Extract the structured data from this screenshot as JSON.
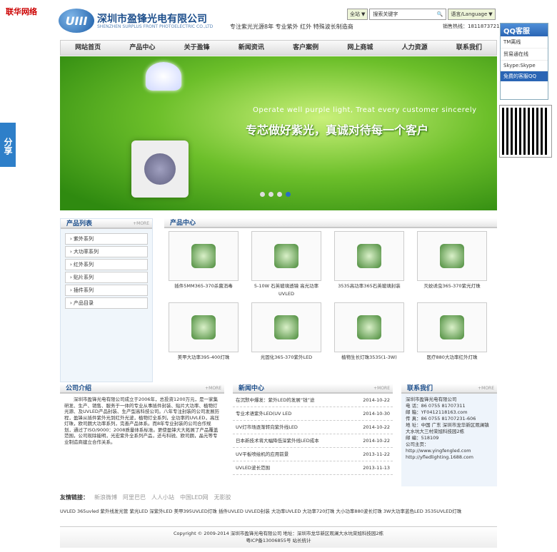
{
  "topleft": "联华网络",
  "header": {
    "logo_text": "UIII",
    "company": "深圳市盈锋光电有限公司",
    "company_en": "SHENZHEN SURPLUS FRONT PHOTOELECTRIC CO.,LTD",
    "slogan": "专注紫光光源8年 专业紫外 红外 特殊波长制造商",
    "hotline": "销售热线：18118737216"
  },
  "search": {
    "scope": "全站",
    "placeholder": "搜索关键字",
    "lang": "语言/Language"
  },
  "nav": [
    "网站首页",
    "产品中心",
    "关于盈锋",
    "新闻资讯",
    "客户案例",
    "网上商城",
    "人力资源",
    "联系我们"
  ],
  "banner": {
    "en": "Operate well purple light, Treat every customer sincerely",
    "cn": "专芯做好紫光，真诚对待每一个客户"
  },
  "qq": {
    "title": "QQ客服",
    "items": [
      "TM离线",
      "贸易通在线",
      "Skype:Skype"
    ],
    "footer": "免费的客服QQ"
  },
  "share": "分享",
  "products_list": {
    "title": "产品列表",
    "more": "+MORE",
    "items": [
      "紫外系列",
      "大功率系列",
      "红外系列",
      "贴片系列",
      "插件系列",
      "产品目录"
    ]
  },
  "products_center": {
    "title": "产品中心",
    "items": [
      "插件5MM365-370杀菌消毒",
      "5-10W 石英玻璃透镜 高光功率UVLED",
      "3535高功率365石英玻璃封装",
      "灭蚊诱虫365-370紫光灯珠",
      "美甲大功率395-400灯珠",
      "光固化365-370紫外LED",
      "植物生长灯珠3535(1-3W)",
      "医疗880大功率红外灯珠"
    ]
  },
  "about": {
    "title": "公司介绍",
    "more": "+MORE",
    "text": "深圳市盈锋光电有限公司成立于2006年，总投资1200万元，是一家集研发、生产、销售、服务于一体的专业从事插件封装、贴片大功率、植物灯光源、及UVLED产品封装、生产型高科技公司。八年专注封装的公司发展历程，盈锋从插件紫外光到红外光波，植物灯全系列，全功率的UVLED，高压灯珠，欧司朗大功率系列，完善产品体系。而8年专业封装的公司合作规划，通过了ISO/9000：2008质量体系标准。更使盈锋大大拓展了产品覆盖范围，公司现除能明，光宏紫外全系列产品，还与科锐、欧司朗，晶元等专业制造商建立合作关系。"
  },
  "news": {
    "title": "新闻中心",
    "more": "+MORE",
    "items": [
      {
        "t": "在沉默中爆发：紫外LED的发展“钱”途",
        "d": "2014-10-22"
      },
      {
        "t": "专业术语紫外LED(UV LED",
        "d": "2014-10-30"
      },
      {
        "t": "UV灯市场逐渐转向紫外线LED",
        "d": "2014-10-22"
      },
      {
        "t": "日本新技术将大幅降低深紫外线LED成本",
        "d": "2014-10-22"
      },
      {
        "t": "UV平板喷绘机的应用前景",
        "d": "2013-11-22"
      },
      {
        "t": "UVLED波长范围",
        "d": "2013-11-13"
      }
    ]
  },
  "contact": {
    "title": "联系我们",
    "more": "+MORE",
    "lines": [
      "深圳市盈锋光电有限公司",
      "电 话：86 0755 81707311",
      "邮 箱：YF0412118163.com",
      "传 真：86 0755 81707231-606",
      "地 址：中国 广东 深圳市龙华新区观澜镇大水坑大三村荣旭科技园2栋",
      "邮 编：518109",
      "公司主页：",
      "http://www.yingfengled.com",
      "http://yfledlighting.1688.com"
    ]
  },
  "links": {
    "label": "友情链接：",
    "items": [
      "新浪微博",
      "阿里巴巴",
      "人人小站",
      "中国LED网",
      "无影胶"
    ]
  },
  "keywords": "UVLED 365uvled 紫外线发光管 紫光LED 深紫外LED 美甲395UVLED灯珠 插件UVLED UVLED封装 大功率UVLED 大功率720灯珠 大小功率880波长灯珠 3W大功率蓝色LED 3535UVLED灯珠",
  "footer": {
    "line1": "Copyright © 2009-2014 深圳市盈锋光电有限公司 地址：深圳市龙华新区观澜大水坑荣旭科技园2栋",
    "line2": "粤ICP备13006855号 站长统计"
  }
}
